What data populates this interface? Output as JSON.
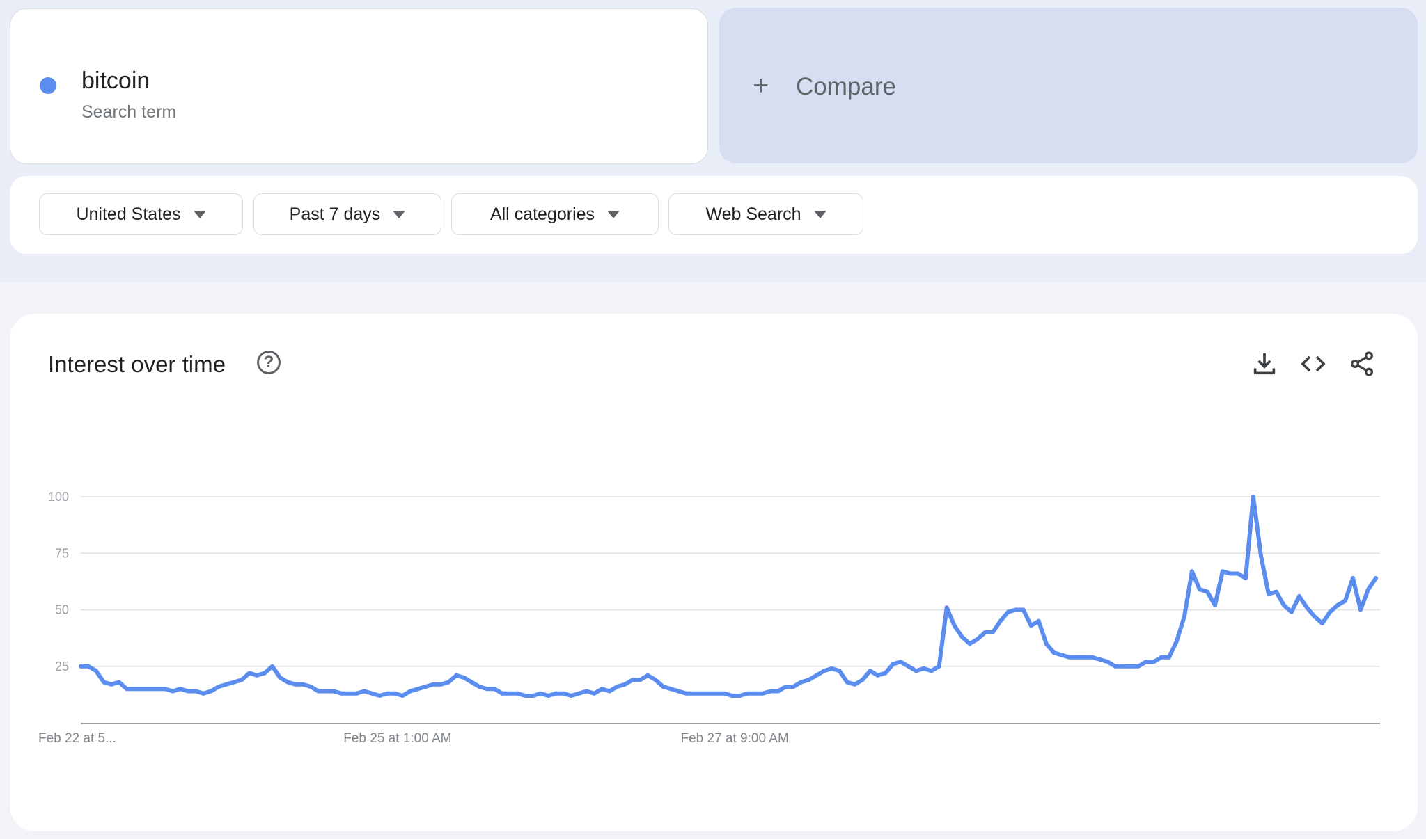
{
  "search_term": {
    "name": "bitcoin",
    "type": "Search term",
    "color": "#5b8def"
  },
  "compare": {
    "icon": "plus-icon",
    "label": "Compare"
  },
  "filters": [
    {
      "label": "United States",
      "icon": "caret-down-icon"
    },
    {
      "label": "Past 7 days",
      "icon": "caret-down-icon"
    },
    {
      "label": "All categories",
      "icon": "caret-down-icon"
    },
    {
      "label": "Web Search",
      "icon": "caret-down-icon"
    }
  ],
  "panel": {
    "title": "Interest over time",
    "help_icon": "help-circle-icon",
    "help_glyph": "?",
    "actions": [
      "download-icon",
      "embed-code-icon",
      "share-icon"
    ]
  },
  "chart_data": {
    "type": "line",
    "title": "Interest over time",
    "xlabel": "",
    "ylabel": "",
    "ylim": [
      0,
      100
    ],
    "yticks": [
      25,
      50,
      75,
      100
    ],
    "grid": true,
    "x_tick_labels": [
      {
        "label": "Feb 22 at 5...",
        "index": 0
      },
      {
        "label": "Feb 25 at 1:00 AM",
        "index": 42
      },
      {
        "label": "Feb 27 at 9:00 AM",
        "index": 86
      }
    ],
    "series": [
      {
        "name": "bitcoin",
        "color": "#5b8def",
        "values": [
          25,
          25,
          23,
          18,
          17,
          18,
          15,
          15,
          15,
          15,
          15,
          15,
          14,
          15,
          14,
          14,
          13,
          14,
          16,
          17,
          18,
          19,
          22,
          21,
          22,
          25,
          20,
          18,
          17,
          17,
          16,
          14,
          14,
          14,
          13,
          13,
          13,
          14,
          13,
          12,
          13,
          13,
          12,
          14,
          15,
          16,
          17,
          17,
          18,
          21,
          20,
          18,
          16,
          15,
          15,
          13,
          13,
          13,
          12,
          12,
          13,
          12,
          13,
          13,
          12,
          13,
          14,
          13,
          15,
          14,
          16,
          17,
          19,
          19,
          21,
          19,
          16,
          15,
          14,
          13,
          13,
          13,
          13,
          13,
          13,
          12,
          12,
          13,
          13,
          13,
          14,
          14,
          16,
          16,
          18,
          19,
          21,
          23,
          24,
          23,
          18,
          17,
          19,
          23,
          21,
          22,
          26,
          27,
          25,
          23,
          24,
          23,
          25,
          51,
          43,
          38,
          35,
          37,
          40,
          40,
          45,
          49,
          50,
          50,
          43,
          45,
          35,
          31,
          30,
          29,
          29,
          29,
          29,
          28,
          27,
          25,
          25,
          25,
          25,
          27,
          27,
          29,
          29,
          36,
          47,
          67,
          59,
          58,
          52,
          67,
          66,
          66,
          64,
          100,
          74,
          57,
          58,
          52,
          49,
          56,
          51,
          47,
          44,
          49,
          52,
          54,
          64,
          50,
          59,
          64
        ]
      }
    ]
  }
}
